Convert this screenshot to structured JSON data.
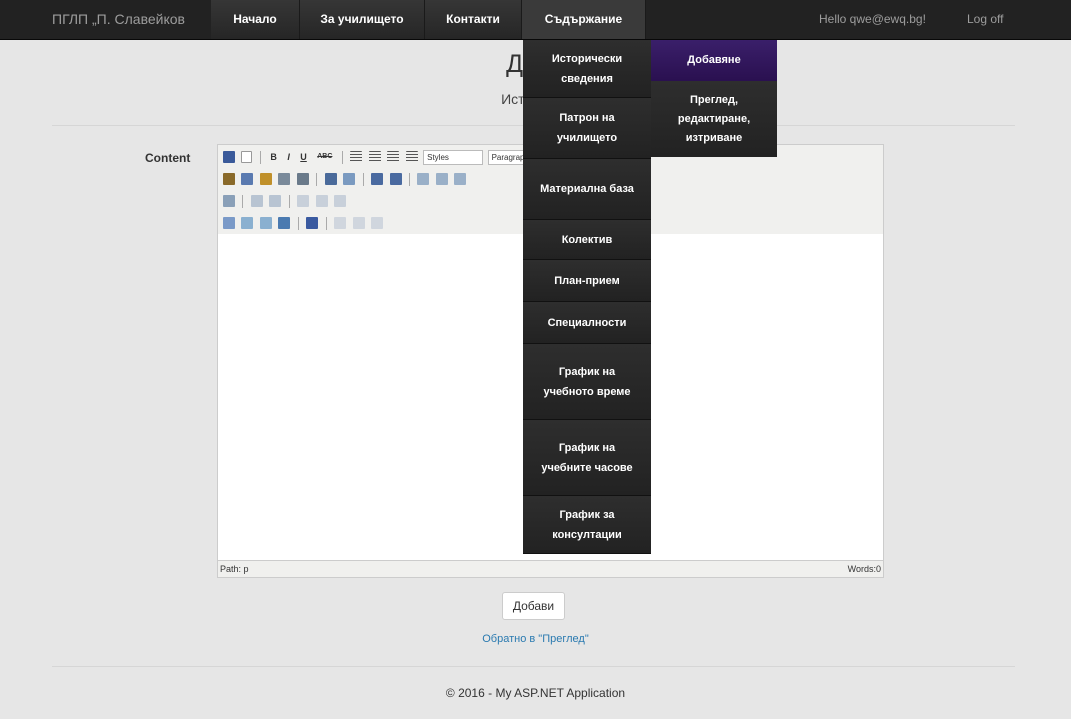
{
  "navbar": {
    "brand": "ПГЛП „П. Славейков",
    "items": [
      "Начало",
      "За училището",
      "Контакти",
      "Съдържание"
    ],
    "greeting": "Hello qwe@ewq.bg!",
    "logoff": "Log off"
  },
  "page": {
    "title": "Доба",
    "subtitle": "Историчес"
  },
  "form": {
    "content_label": "Content",
    "submit_label": "Добави",
    "back_link": "Обратно в \"Преглед\""
  },
  "editor": {
    "styles_select": "Styles",
    "format_select": "Paragraph",
    "path": "Path: p",
    "words": "Words:0",
    "colors": {
      "toolbar_bg": "#f0f0ee"
    }
  },
  "dropdown": {
    "items": [
      "Исторически сведения",
      "Патрон на училището",
      "Материална база",
      "Колектив",
      "План-прием",
      "Специалности",
      "График на учебното време",
      "График на учебните часове",
      "График за консултации"
    ],
    "submenu": [
      "Добавяне",
      "Преглед, редактиране, изтриване"
    ]
  },
  "footer": {
    "text": "© 2016 - My ASP.NET Application"
  },
  "colors": {
    "navbar_bg": "#222222",
    "page_bg": "#e6e6e6",
    "submenu_active": "#2a1050",
    "link": "#2a7ab0"
  }
}
